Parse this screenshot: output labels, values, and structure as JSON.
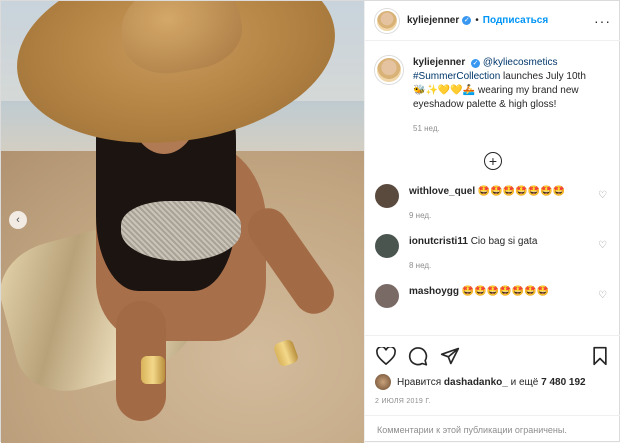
{
  "post": {
    "username": "kyliejenner",
    "follow_label": "Подписаться",
    "caption": {
      "mention": "@kyliecosmetics",
      "hashtag": "#SummerCollection",
      "text_after_hashtag": "launches July 10th",
      "emojis": "🐝✨💛💛🚣",
      "text_end": "wearing my brand new eyeshadow palette & high gloss!",
      "age": "51 нед."
    },
    "comments": [
      {
        "username": "withlove_quel",
        "text": "🤩🤩🤩🤩🤩🤩🤩",
        "age": "9 нед.",
        "avatar_color": "#5a4a3e"
      },
      {
        "username": "ionutcristi11",
        "text": "Cio bag si gata",
        "age": "8 нед.",
        "avatar_color": "#4a5550"
      },
      {
        "username": "mashoygg",
        "text": "🤩🤩🤩🤩🤩🤩🤩",
        "age": "",
        "avatar_color": "#7a6a66"
      }
    ],
    "likes": {
      "prefix": "Нравится",
      "user": "dashadanko_",
      "connector": "и ещё",
      "count": "7 480 192"
    },
    "date": "2 ИЮЛЯ 2019 Г.",
    "comments_restricted": "Комментарии к этой публикации ограничены."
  },
  "icons": {
    "verified": "verified-badge-icon",
    "more": "more-options-icon",
    "load_more": "plus-circle-icon",
    "like": "heart-icon",
    "comment": "comment-icon",
    "share": "share-icon",
    "save": "bookmark-icon",
    "prev": "chevron-left-icon"
  },
  "colors": {
    "link": "#00376b",
    "follow": "#0095f6",
    "verified": "#3897f0",
    "secondary_text": "#8e8e8e"
  }
}
